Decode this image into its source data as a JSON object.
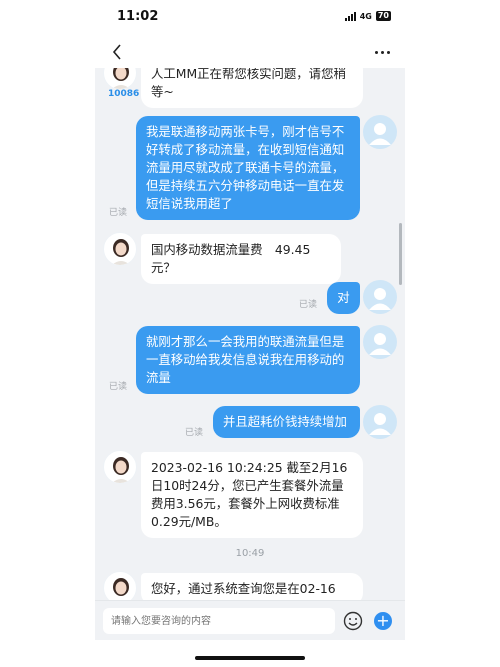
{
  "status_bar": {
    "time": "11:02",
    "network": "4G",
    "battery": "70"
  },
  "agent_brand": "10086",
  "messages": [
    {
      "from": "agent",
      "text": "人工MM正在帮您核实问题，请您稍等~"
    },
    {
      "from": "user",
      "text": "我是联通移动两张卡号，刚才信号不好转成了移动流量，在收到短信通知流量用尽就改成了联通卡号的流量，但是持续五六分钟移动电话一直在发短信说我用超了",
      "read": "已读"
    },
    {
      "from": "agent",
      "text": "国内移动数据流量费　49.45元？"
    },
    {
      "from": "user",
      "text": "对",
      "read": "已读"
    },
    {
      "from": "user",
      "text": "就刚才那么一会我用的联通流量但是一直移动给我发信息说我在用移动的流量",
      "read": "已读"
    },
    {
      "from": "user",
      "text": "并且超耗价钱持续增加",
      "read": "已读"
    },
    {
      "from": "agent",
      "text": "2023-02-16 10:24:25 截至2月16日10时24分，您已产生套餐外流量费用3.56元，套餐外上网收费标准0.29元/MB。"
    },
    {
      "time": "10:49"
    },
    {
      "from": "agent",
      "text": "您好，通过系统查询您是在02-16"
    }
  ],
  "input": {
    "placeholder": "请输入您要咨询的内容"
  },
  "colors": {
    "user_bubble": "#3a9bf0",
    "agent_bubble": "#ffffff",
    "background": "#f0f2f5",
    "accent": "#2f8ff0"
  },
  "icons": [
    "back-icon",
    "more-icon",
    "emoji-icon",
    "plus-icon",
    "user-avatar-icon",
    "agent-avatar"
  ]
}
